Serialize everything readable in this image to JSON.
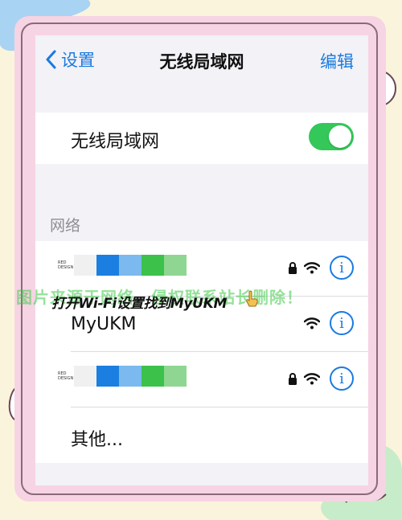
{
  "nav": {
    "back_label": "设置",
    "title": "无线局域网",
    "edit_label": "编辑"
  },
  "wifi_toggle": {
    "label": "无线局域网",
    "on": true
  },
  "networks_section": {
    "header": "网络",
    "redacted_logo_text_line1": "RED",
    "redacted_logo_text_line2": "DESIGN",
    "rows": [
      {
        "label": "",
        "redacted": true,
        "locked": true,
        "wifi": true,
        "info": true
      },
      {
        "label": "MyUKM",
        "redacted": false,
        "locked": false,
        "wifi": true,
        "info": true
      },
      {
        "label": "",
        "redacted": true,
        "locked": true,
        "wifi": true,
        "info": true
      },
      {
        "label": "其他...",
        "redacted": false,
        "locked": false,
        "wifi": false,
        "info": false
      }
    ],
    "redaction_colors": [
      "#f0f0f0",
      "#1a7fe0",
      "#7cb9ee",
      "#3cc14a",
      "#8fd692"
    ]
  },
  "caption": "打开Wi-Fi设置找到MyUKM",
  "watermark": "图片来源于网络，侵权联系站长删除！",
  "colors": {
    "accent_blue": "#1a7ae0",
    "switch_green": "#34c759",
    "background_cream": "#fbf4dc",
    "frame_pink": "#f6d4e3"
  },
  "info_glyph": "i"
}
